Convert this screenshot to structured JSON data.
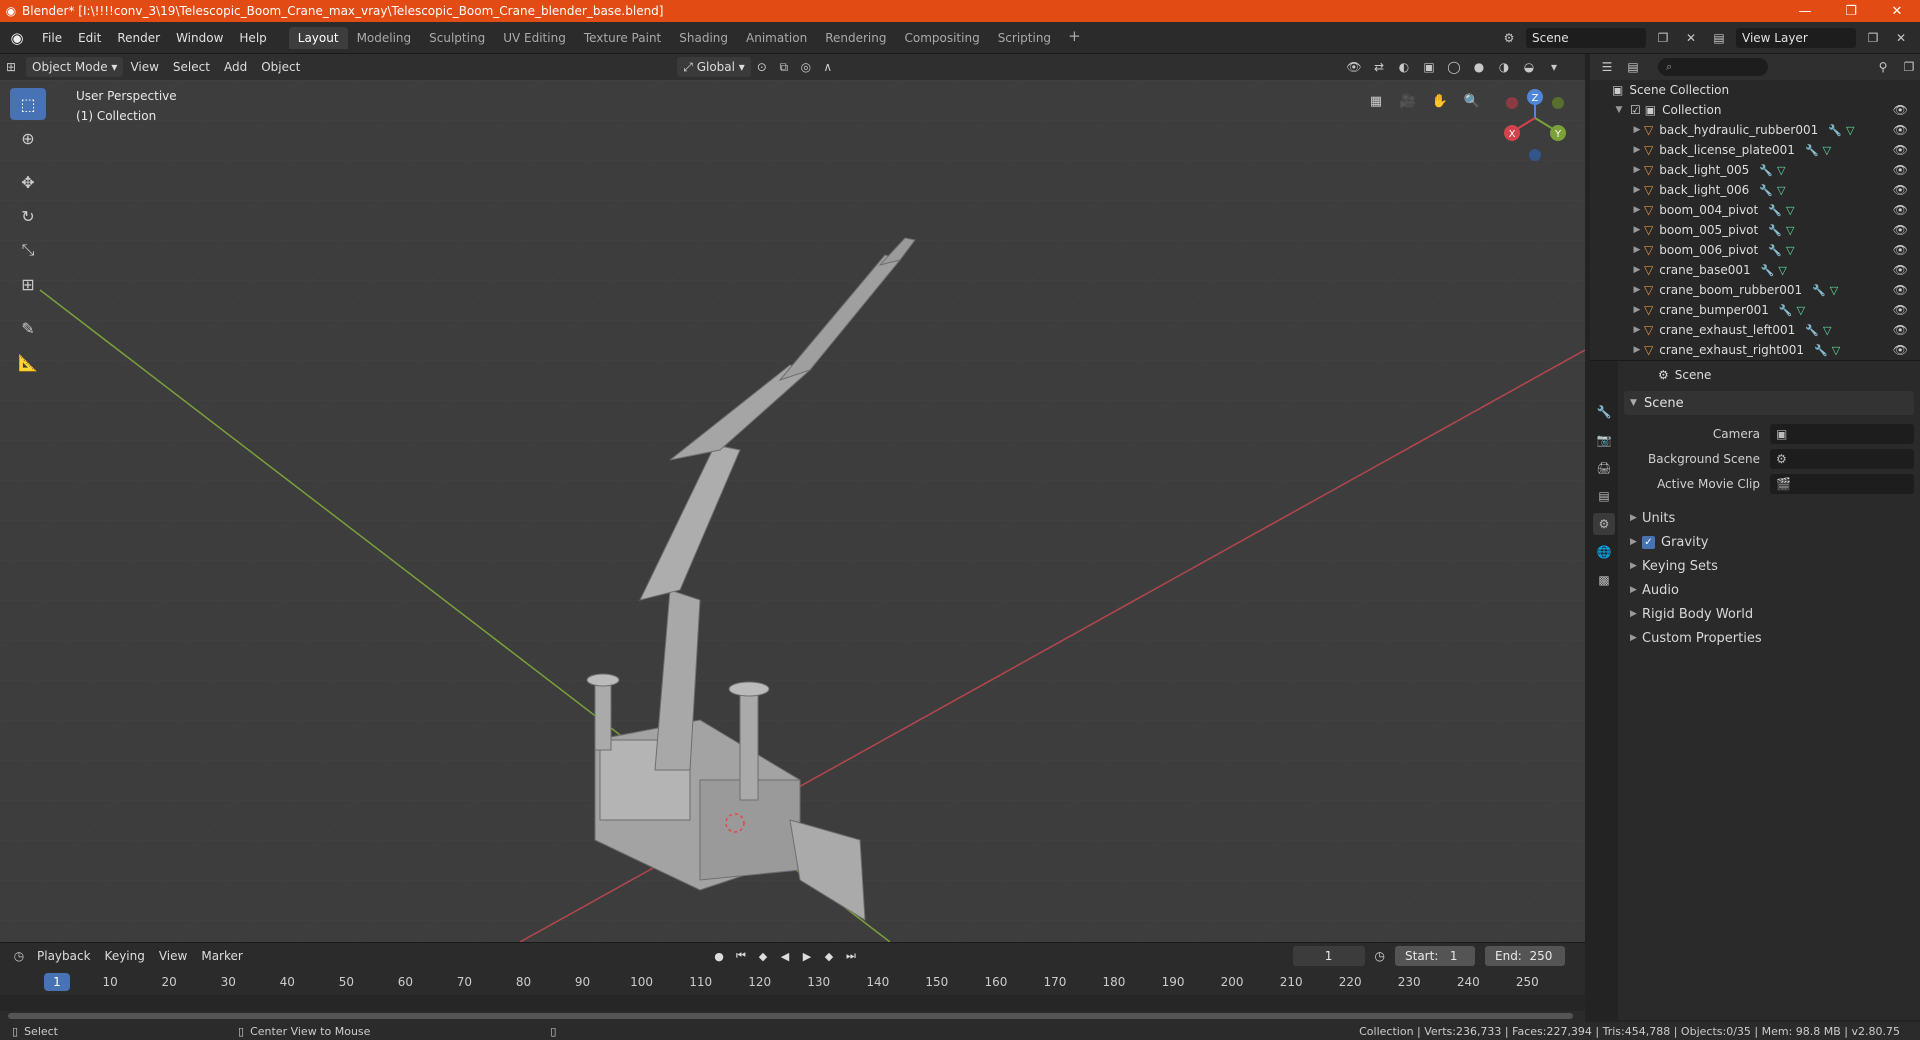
{
  "window": {
    "title": "Blender* [I:\\!!!!conv_3\\19\\Telescopic_Boom_Crane_max_vray\\Telescopic_Boom_Crane_blender_base.blend]",
    "controls": [
      "—",
      "❐",
      "✕"
    ]
  },
  "menu": [
    "File",
    "Edit",
    "Render",
    "Window",
    "Help"
  ],
  "workspaces": [
    "Layout",
    "Modeling",
    "Sculpting",
    "UV Editing",
    "Texture Paint",
    "Shading",
    "Animation",
    "Rendering",
    "Compositing",
    "Scripting"
  ],
  "active_workspace": "Layout",
  "scene_field": "Scene",
  "view_layer_field": "View Layer",
  "viewport": {
    "mode": "Object Mode",
    "menus": [
      "View",
      "Select",
      "Add",
      "Object"
    ],
    "orientation": "Global",
    "overlay_line1": "User Perspective",
    "overlay_line2": "(1) Collection",
    "gizmo_axes": {
      "x": "X",
      "y": "Y",
      "z": "Z"
    }
  },
  "outliner": {
    "root": "Scene Collection",
    "collection": "Collection",
    "items": [
      "back_hydraulic_rubber001",
      "back_license_plate001",
      "back_light_005",
      "back_light_006",
      "boom_004_pivot",
      "boom_005_pivot",
      "boom_006_pivot",
      "crane_base001",
      "crane_boom_rubber001",
      "crane_bumper001",
      "crane_exhaust_left001",
      "crane_exhaust_right001"
    ]
  },
  "properties": {
    "header": "Scene",
    "panel": "Scene",
    "camera_label": "Camera",
    "background_scene_label": "Background Scene",
    "active_movie_clip_label": "Active Movie Clip",
    "subpanels": [
      "Units",
      "Gravity",
      "Keying Sets",
      "Audio",
      "Rigid Body World",
      "Custom Properties"
    ],
    "gravity_checked": true
  },
  "timeline": {
    "menus": [
      "Playback",
      "Keying",
      "View",
      "Marker"
    ],
    "current_frame": "1",
    "start_label": "Start:",
    "start_value": "1",
    "end_label": "End:",
    "end_value": "250",
    "ruler_labels": [
      "10",
      "20",
      "30",
      "40",
      "50",
      "60",
      "70",
      "80",
      "90",
      "100",
      "110",
      "120",
      "130",
      "140",
      "150",
      "160",
      "170",
      "180",
      "190",
      "200",
      "210",
      "220",
      "230",
      "240",
      "250"
    ],
    "cursor_label": "1"
  },
  "status": {
    "left_action": "Select",
    "middle_action": "Center View to Mouse",
    "stats": "Collection | Verts:236,733 | Faces:227,394 | Tris:454,788 | Objects:0/35 | Mem: 98.8 MB | v2.80.75"
  },
  "colors": {
    "title_bar": "#e34b14",
    "accent": "#4772b3",
    "grid_x_axis": "#b5474c",
    "grid_y_axis": "#7aa03a",
    "object_icon": "#e8913a"
  }
}
